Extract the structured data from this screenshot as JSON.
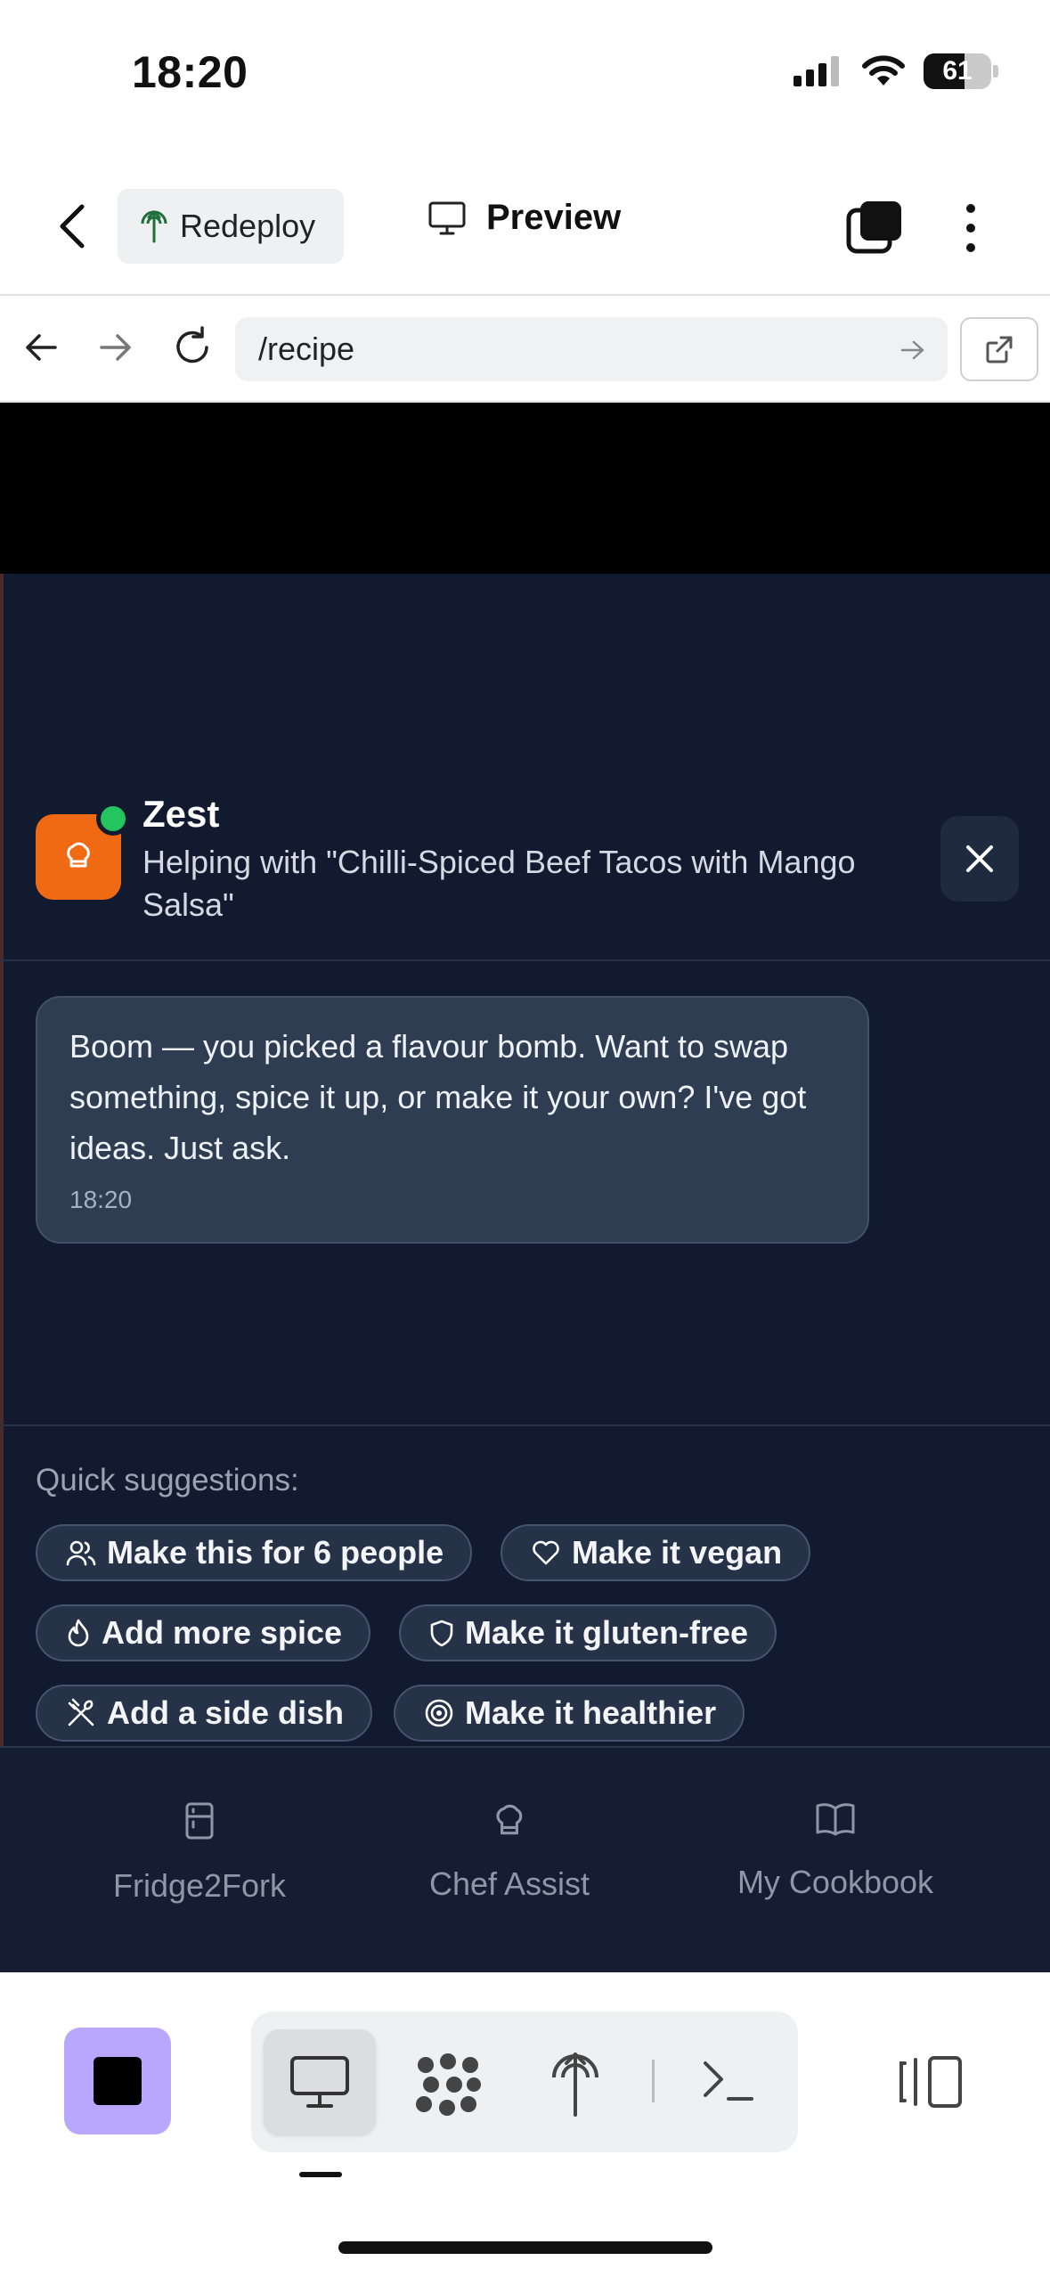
{
  "status_bar": {
    "time": "18:20",
    "battery": "61",
    "battery_level": 0.61
  },
  "header": {
    "redeploy_label": "Redeploy",
    "preview_label": "Preview"
  },
  "browser": {
    "url": "/recipe"
  },
  "chat": {
    "assistant_name": "Zest",
    "helping_text": "Helping with \"Chilli-Spiced Beef Tacos with Mango Salsa\"",
    "message": {
      "text": "Boom — you picked a flavour bomb. Want to swap something, spice it up, or make it your own? I've got ideas. Just ask.",
      "time": "18:20"
    },
    "suggestions_title": "Quick suggestions:",
    "suggestions": [
      {
        "label": "Make this for 6 people",
        "icon": "users-icon"
      },
      {
        "label": "Make it vegan",
        "icon": "heart-icon"
      },
      {
        "label": "Add more spice",
        "icon": "flame-icon"
      },
      {
        "label": "Make it gluten-free",
        "icon": "shield-icon"
      },
      {
        "label": "Add a side dish",
        "icon": "utensils-icon"
      },
      {
        "label": "Make it healthier",
        "icon": "target-icon"
      }
    ]
  },
  "bottom_nav": [
    {
      "label": "Fridge2Fork",
      "icon": "fridge-icon"
    },
    {
      "label": "Chef Assist",
      "icon": "chef-hat-icon"
    },
    {
      "label": "My Cookbook",
      "icon": "book-icon"
    }
  ],
  "colors": {
    "accent_orange": "#f06a13",
    "online_green": "#22c55e",
    "stop_purple": "#b9a7ff",
    "app_bg": "#111a2e"
  }
}
